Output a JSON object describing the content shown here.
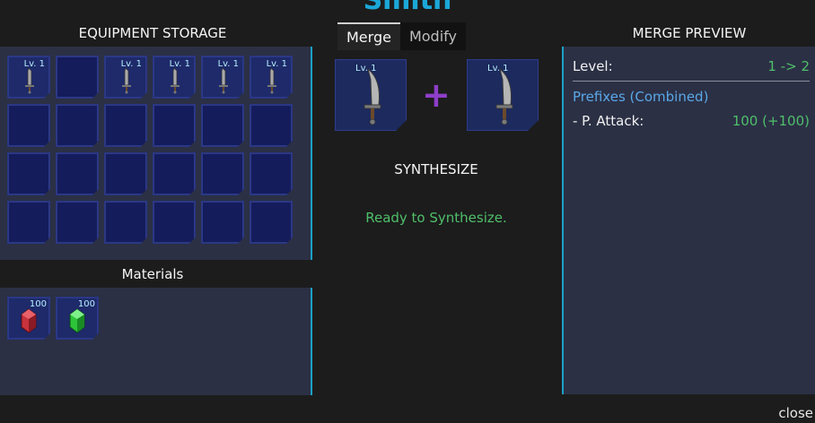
{
  "window_title": "Smith",
  "storage": {
    "title": "EQUIPMENT STORAGE",
    "level_label": "Lv. 1"
  },
  "materials": {
    "title": "Materials",
    "items": [
      {
        "icon": "red-gem-icon",
        "count": "100",
        "color": "#c8323c"
      },
      {
        "icon": "green-gem-icon",
        "count": "100",
        "color": "#2ec43a"
      }
    ]
  },
  "tabs": {
    "merge": "Merge",
    "modify": "Modify"
  },
  "merge": {
    "level_label": "Lv. 1",
    "plus": "+",
    "synthesize": "SYNTHESIZE",
    "status": "Ready to Synthesize."
  },
  "preview": {
    "title": "MERGE PREVIEW",
    "level_label": "Level:",
    "level_value": "1 -> 2",
    "prefix_header": "Prefixes (Combined)",
    "stat_label": "- P. Attack:",
    "stat_value": "100 (+100)"
  },
  "close": "close",
  "colors": {
    "accent": "#1aa0c8",
    "title": "#1ba8d8",
    "ok": "#4fbf6a",
    "plus": "#8e3ec8"
  }
}
